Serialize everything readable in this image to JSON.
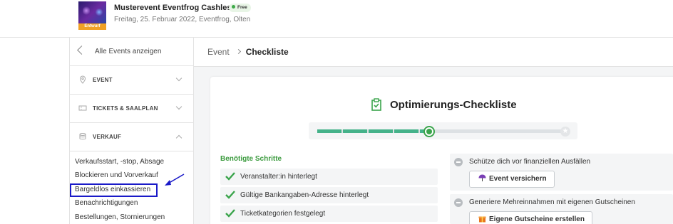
{
  "event": {
    "title": "Musterevent Eventfrog Cashless",
    "free_badge": "Free",
    "subtitle": "Freitag, 25. Februar 2022, Eventfrog, Olten",
    "draft_badge": "Entwurf"
  },
  "sidebar": {
    "back_label": "Alle Events anzeigen",
    "sections": [
      {
        "label": "EVENT",
        "icon": "location-pin-icon",
        "expanded": false
      },
      {
        "label": "TICKETS & SAALPLAN",
        "icon": "ticket-icon",
        "expanded": false
      },
      {
        "label": "VERKAUF",
        "icon": "coins-icon",
        "expanded": true
      }
    ],
    "verkauf_items": [
      "Verkaufsstart, -stop, Absage",
      "Blockieren und Vorverkauf",
      "Bargeldlos einkassieren",
      "Benachrichtigungen",
      "Bestellungen, Stornierungen"
    ],
    "highlighted_item": "Bargeldlos einkassieren"
  },
  "breadcrumb": {
    "parent": "Event",
    "current": "Checkliste"
  },
  "checklist": {
    "title": "Optimierungs-Checkliste",
    "progress_fraction": 0.45,
    "steps_title": "Benötigte Schritte",
    "steps": [
      "Veranstalter:in hinterlegt",
      "Gültige Bankangaben-Adresse hinterlegt",
      "Ticketkategorien festgelegt"
    ],
    "tips": [
      {
        "text": "Schütze dich vor finanziellen Ausfällen",
        "button": "Event versichern",
        "button_icon": "umbrella-icon"
      },
      {
        "text": "Generiere Mehreinnahmen mit eigenen Gutscheinen",
        "button": "Eigene Gutscheine erstellen",
        "button_icon": "gift-icon"
      }
    ]
  },
  "colors": {
    "accent_green": "#3aa44b",
    "progress_teal": "#45b28a",
    "draft_orange": "#f0a126",
    "highlight_blue": "#1a1ac8"
  }
}
